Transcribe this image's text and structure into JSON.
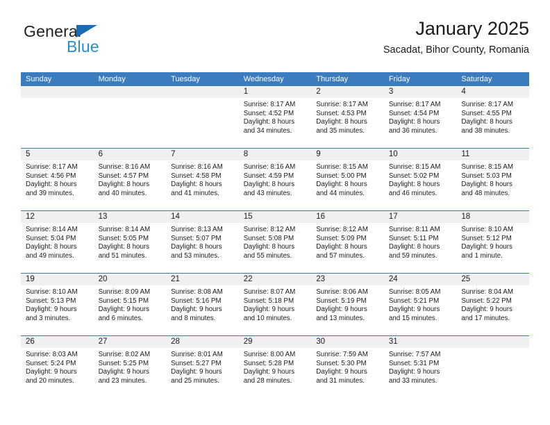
{
  "brand": {
    "name_part1": "General",
    "name_part2": "Blue",
    "triangle_color": "#1b6cb5",
    "blue_text_color": "#2b8bd4"
  },
  "header": {
    "title": "January 2025",
    "subtitle": "Sacadat, Bihor County, Romania"
  },
  "theme": {
    "header_bar_color": "#3b7cbf",
    "day_strip_color": "#f0f0f0",
    "text_color": "#1a1a1a"
  },
  "weekdays": [
    "Sunday",
    "Monday",
    "Tuesday",
    "Wednesday",
    "Thursday",
    "Friday",
    "Saturday"
  ],
  "weeks": [
    [
      {
        "day": "",
        "sunrise": "",
        "sunset": "",
        "daylight1": "",
        "daylight2": "",
        "empty": true
      },
      {
        "day": "",
        "sunrise": "",
        "sunset": "",
        "daylight1": "",
        "daylight2": "",
        "empty": true
      },
      {
        "day": "",
        "sunrise": "",
        "sunset": "",
        "daylight1": "",
        "daylight2": "",
        "empty": true
      },
      {
        "day": "1",
        "sunrise": "Sunrise: 8:17 AM",
        "sunset": "Sunset: 4:52 PM",
        "daylight1": "Daylight: 8 hours",
        "daylight2": "and 34 minutes."
      },
      {
        "day": "2",
        "sunrise": "Sunrise: 8:17 AM",
        "sunset": "Sunset: 4:53 PM",
        "daylight1": "Daylight: 8 hours",
        "daylight2": "and 35 minutes."
      },
      {
        "day": "3",
        "sunrise": "Sunrise: 8:17 AM",
        "sunset": "Sunset: 4:54 PM",
        "daylight1": "Daylight: 8 hours",
        "daylight2": "and 36 minutes."
      },
      {
        "day": "4",
        "sunrise": "Sunrise: 8:17 AM",
        "sunset": "Sunset: 4:55 PM",
        "daylight1": "Daylight: 8 hours",
        "daylight2": "and 38 minutes."
      }
    ],
    [
      {
        "day": "5",
        "sunrise": "Sunrise: 8:17 AM",
        "sunset": "Sunset: 4:56 PM",
        "daylight1": "Daylight: 8 hours",
        "daylight2": "and 39 minutes."
      },
      {
        "day": "6",
        "sunrise": "Sunrise: 8:16 AM",
        "sunset": "Sunset: 4:57 PM",
        "daylight1": "Daylight: 8 hours",
        "daylight2": "and 40 minutes."
      },
      {
        "day": "7",
        "sunrise": "Sunrise: 8:16 AM",
        "sunset": "Sunset: 4:58 PM",
        "daylight1": "Daylight: 8 hours",
        "daylight2": "and 41 minutes."
      },
      {
        "day": "8",
        "sunrise": "Sunrise: 8:16 AM",
        "sunset": "Sunset: 4:59 PM",
        "daylight1": "Daylight: 8 hours",
        "daylight2": "and 43 minutes."
      },
      {
        "day": "9",
        "sunrise": "Sunrise: 8:15 AM",
        "sunset": "Sunset: 5:00 PM",
        "daylight1": "Daylight: 8 hours",
        "daylight2": "and 44 minutes."
      },
      {
        "day": "10",
        "sunrise": "Sunrise: 8:15 AM",
        "sunset": "Sunset: 5:02 PM",
        "daylight1": "Daylight: 8 hours",
        "daylight2": "and 46 minutes."
      },
      {
        "day": "11",
        "sunrise": "Sunrise: 8:15 AM",
        "sunset": "Sunset: 5:03 PM",
        "daylight1": "Daylight: 8 hours",
        "daylight2": "and 48 minutes."
      }
    ],
    [
      {
        "day": "12",
        "sunrise": "Sunrise: 8:14 AM",
        "sunset": "Sunset: 5:04 PM",
        "daylight1": "Daylight: 8 hours",
        "daylight2": "and 49 minutes."
      },
      {
        "day": "13",
        "sunrise": "Sunrise: 8:14 AM",
        "sunset": "Sunset: 5:05 PM",
        "daylight1": "Daylight: 8 hours",
        "daylight2": "and 51 minutes."
      },
      {
        "day": "14",
        "sunrise": "Sunrise: 8:13 AM",
        "sunset": "Sunset: 5:07 PM",
        "daylight1": "Daylight: 8 hours",
        "daylight2": "and 53 minutes."
      },
      {
        "day": "15",
        "sunrise": "Sunrise: 8:12 AM",
        "sunset": "Sunset: 5:08 PM",
        "daylight1": "Daylight: 8 hours",
        "daylight2": "and 55 minutes."
      },
      {
        "day": "16",
        "sunrise": "Sunrise: 8:12 AM",
        "sunset": "Sunset: 5:09 PM",
        "daylight1": "Daylight: 8 hours",
        "daylight2": "and 57 minutes."
      },
      {
        "day": "17",
        "sunrise": "Sunrise: 8:11 AM",
        "sunset": "Sunset: 5:11 PM",
        "daylight1": "Daylight: 8 hours",
        "daylight2": "and 59 minutes."
      },
      {
        "day": "18",
        "sunrise": "Sunrise: 8:10 AM",
        "sunset": "Sunset: 5:12 PM",
        "daylight1": "Daylight: 9 hours",
        "daylight2": "and 1 minute."
      }
    ],
    [
      {
        "day": "19",
        "sunrise": "Sunrise: 8:10 AM",
        "sunset": "Sunset: 5:13 PM",
        "daylight1": "Daylight: 9 hours",
        "daylight2": "and 3 minutes."
      },
      {
        "day": "20",
        "sunrise": "Sunrise: 8:09 AM",
        "sunset": "Sunset: 5:15 PM",
        "daylight1": "Daylight: 9 hours",
        "daylight2": "and 6 minutes."
      },
      {
        "day": "21",
        "sunrise": "Sunrise: 8:08 AM",
        "sunset": "Sunset: 5:16 PM",
        "daylight1": "Daylight: 9 hours",
        "daylight2": "and 8 minutes."
      },
      {
        "day": "22",
        "sunrise": "Sunrise: 8:07 AM",
        "sunset": "Sunset: 5:18 PM",
        "daylight1": "Daylight: 9 hours",
        "daylight2": "and 10 minutes."
      },
      {
        "day": "23",
        "sunrise": "Sunrise: 8:06 AM",
        "sunset": "Sunset: 5:19 PM",
        "daylight1": "Daylight: 9 hours",
        "daylight2": "and 13 minutes."
      },
      {
        "day": "24",
        "sunrise": "Sunrise: 8:05 AM",
        "sunset": "Sunset: 5:21 PM",
        "daylight1": "Daylight: 9 hours",
        "daylight2": "and 15 minutes."
      },
      {
        "day": "25",
        "sunrise": "Sunrise: 8:04 AM",
        "sunset": "Sunset: 5:22 PM",
        "daylight1": "Daylight: 9 hours",
        "daylight2": "and 17 minutes."
      }
    ],
    [
      {
        "day": "26",
        "sunrise": "Sunrise: 8:03 AM",
        "sunset": "Sunset: 5:24 PM",
        "daylight1": "Daylight: 9 hours",
        "daylight2": "and 20 minutes."
      },
      {
        "day": "27",
        "sunrise": "Sunrise: 8:02 AM",
        "sunset": "Sunset: 5:25 PM",
        "daylight1": "Daylight: 9 hours",
        "daylight2": "and 23 minutes."
      },
      {
        "day": "28",
        "sunrise": "Sunrise: 8:01 AM",
        "sunset": "Sunset: 5:27 PM",
        "daylight1": "Daylight: 9 hours",
        "daylight2": "and 25 minutes."
      },
      {
        "day": "29",
        "sunrise": "Sunrise: 8:00 AM",
        "sunset": "Sunset: 5:28 PM",
        "daylight1": "Daylight: 9 hours",
        "daylight2": "and 28 minutes."
      },
      {
        "day": "30",
        "sunrise": "Sunrise: 7:59 AM",
        "sunset": "Sunset: 5:30 PM",
        "daylight1": "Daylight: 9 hours",
        "daylight2": "and 31 minutes."
      },
      {
        "day": "31",
        "sunrise": "Sunrise: 7:57 AM",
        "sunset": "Sunset: 5:31 PM",
        "daylight1": "Daylight: 9 hours",
        "daylight2": "and 33 minutes."
      },
      {
        "day": "",
        "sunrise": "",
        "sunset": "",
        "daylight1": "",
        "daylight2": "",
        "empty": true
      }
    ]
  ]
}
